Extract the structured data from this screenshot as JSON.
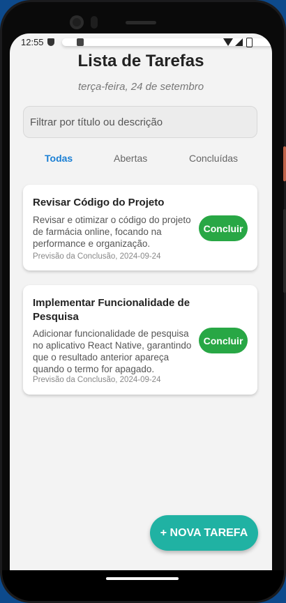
{
  "status": {
    "time": "12:55",
    "icons": [
      "shield-icon",
      "sd-card-icon",
      "a-icon",
      "wifi-icon",
      "signal-icon",
      "battery-icon"
    ]
  },
  "header": {
    "title": "Lista de Tarefas",
    "date": "terça-feira, 24 de setembro"
  },
  "filter": {
    "placeholder": "Filtrar por título ou descrição"
  },
  "tabs": [
    {
      "label": "Todas",
      "active": true
    },
    {
      "label": "Abertas",
      "active": false
    },
    {
      "label": "Concluídas",
      "active": false
    }
  ],
  "tasks": [
    {
      "title": "Revisar Código do Projeto",
      "description": "Revisar e otimizar o código do projeto de farmácia online, focando na performance e organização.",
      "due": "Previsão da Conclusão, 2024-09-24",
      "action": "Concluir"
    },
    {
      "title": "Implementar Funcionalidade de Pesquisa",
      "description": "Adicionar funcionalidade de pesquisa no aplicativo React Native, garantindo que o resultado anterior apareça quando o termo for apagado.",
      "due": "Previsão da Conclusão, 2024-09-24",
      "action": "Concluir"
    }
  ],
  "fab": {
    "label": "+ NOVA TAREFA"
  },
  "colors": {
    "accent": "#1a7fd4",
    "success": "#28a745",
    "fab": "#20b2a3"
  }
}
